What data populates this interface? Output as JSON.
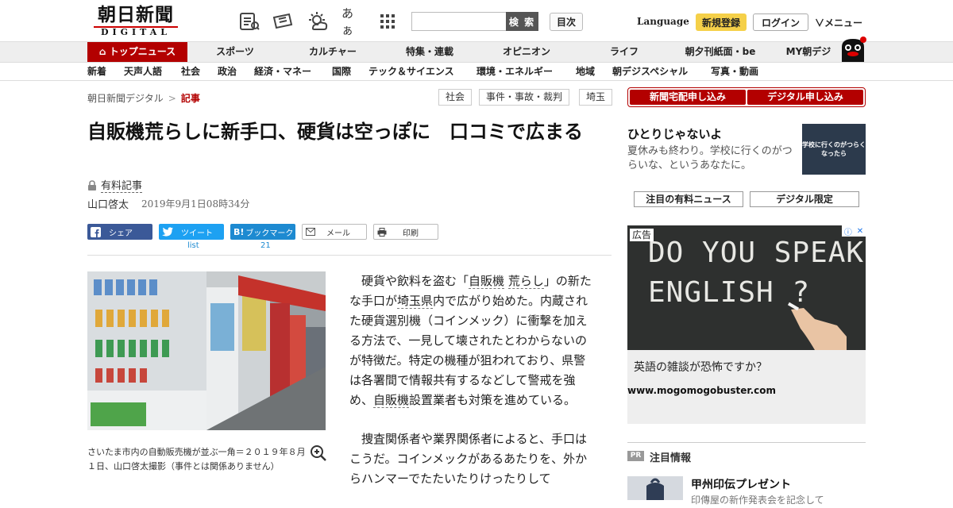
{
  "header": {
    "logo_main": "朝日新聞",
    "logo_sub": "DIGITAL",
    "font_size_toggle": "あぁ",
    "search_placeholder": "",
    "search_button": "検 索",
    "toc_button": "目次",
    "language": "Language",
    "register_button": "新規登録",
    "login_button": "ログイン",
    "menu_button": "メニュー"
  },
  "nav_primary": [
    "トップニュース",
    "スポーツ",
    "カルチャー",
    "特集・連載",
    "オピニオン",
    "ライフ",
    "朝夕刊紙面・be",
    "MY朝デジ"
  ],
  "nav_secondary": [
    "新着",
    "天声人語",
    "社会",
    "政治",
    "経済・マネー",
    "国際",
    "テック＆サイエンス",
    "環境・エネルギー",
    "地域",
    "朝デジスペシャル",
    "写真・動画"
  ],
  "breadcrumb": {
    "home": "朝日新聞デジタル",
    "separator": ">",
    "current": "記事"
  },
  "tags": [
    "社会",
    "事件・事故・裁判",
    "埼玉"
  ],
  "article": {
    "title": "自販機荒らしに新手口、硬貨は空っぽに　口コミで広まる",
    "paid_label": "有料記事",
    "author": "山口啓太",
    "date": "2019年9月1日08時34分",
    "caption": "さいたま市内の自動販売機が並ぶ一角＝２０１９年８月１日、山口啓太撮影（事件とは関係ありません）",
    "p1": {
      "a": "硬貨や飲料を盗む「",
      "kw1": "自販機",
      "b": " ",
      "kw2": "荒らし",
      "c": "」の新たな手口が",
      "kw3": "埼玉県",
      "d": "内で広がり始めた。内蔵された硬貨選別機（コインメック）に衝撃を加える方法で、一見して壊されたとわからないのが特徴だ。特定の機種が狙われており、県警は各署間で情報共有するなどして警戒を強め、",
      "kw4": "自販機",
      "e": "設置業者も対策を進めている。"
    },
    "p2": "捜査関係者や業界関係者によると、手口はこうだ。コインメックがあるあたりを、外からハンマーでたたいたりけったりして"
  },
  "share": {
    "facebook": "シェア",
    "twitter": "ツイート",
    "hatena": "ブックマーク",
    "mail": "メール",
    "print": "印刷",
    "twitter_count": "list",
    "hatena_count": "21"
  },
  "sidebar": {
    "delivery_button": "新聞宅配申し込み",
    "digital_button": "デジタル申し込み",
    "feature_title": "ひとりじゃないよ",
    "feature_text": "夏休みも終わり。学校に行くのがつらいな、というあなたに。",
    "feature_image_text": "学校に行くのがつらくなったら",
    "tab_paid": "注目の有料ニュース",
    "tab_digital": "デジタル限定",
    "ad": {
      "label": "広告",
      "board_line1": "DO YOU SPEAK",
      "board_line2": "ENGLISH ?",
      "headline": "英語の雑談が恐怖ですか？",
      "url": "www.mogomogobuster.com"
    },
    "pr_badge": "PR",
    "pr_title": "注目情報",
    "pr_item": "甲州印伝プレゼント",
    "pr_sub": "印傳屋の新作発表会を記念して"
  },
  "colors": {
    "brand_red": "#b30000",
    "register_yellow": "#f5d049",
    "facebook": "#3b5998",
    "twitter": "#1da1f2",
    "hatena": "#1d8ad1"
  }
}
